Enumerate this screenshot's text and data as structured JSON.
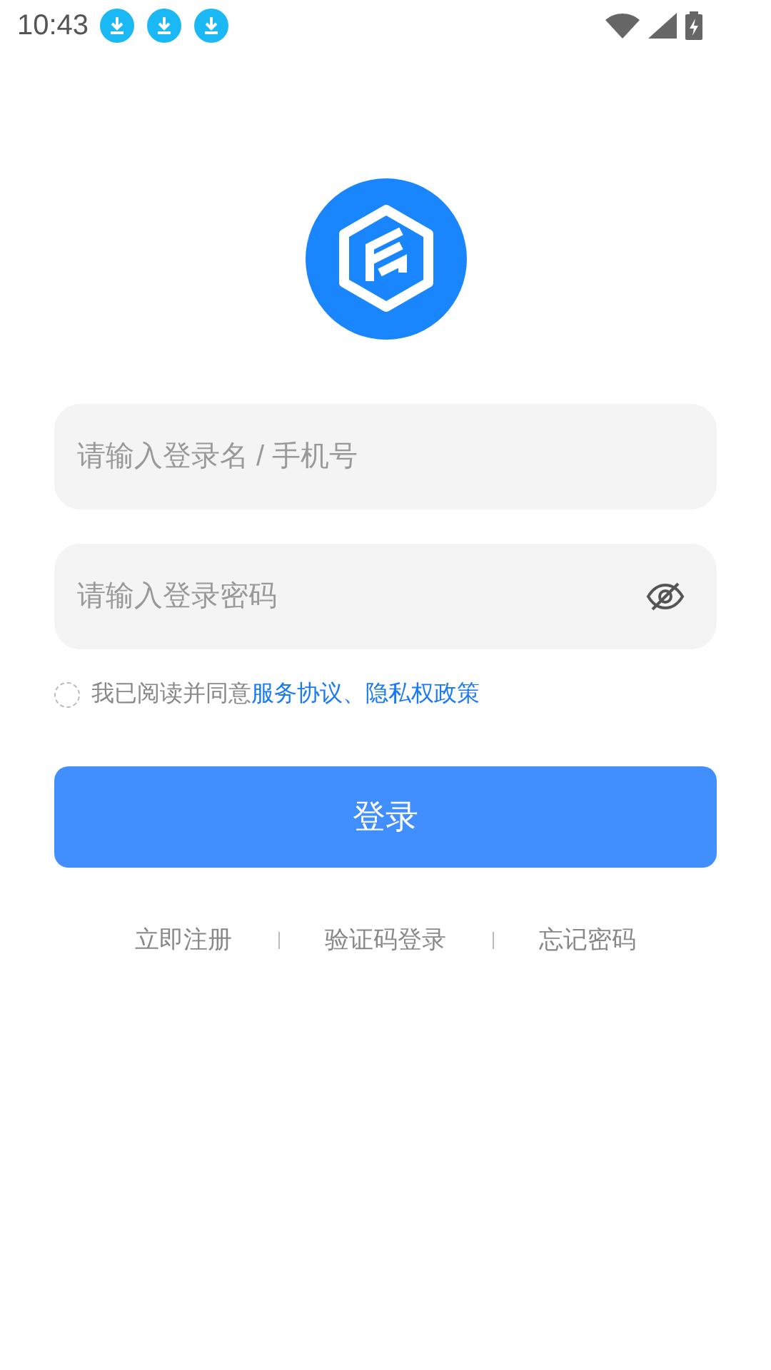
{
  "status_bar": {
    "time": "10:43",
    "notifications": [
      {
        "kind": "download"
      },
      {
        "kind": "download"
      },
      {
        "kind": "download"
      }
    ]
  },
  "login_name_field": {
    "placeholder": "请输入登录名 / 手机号"
  },
  "password_field": {
    "placeholder": "请输入登录密码",
    "password_visible": false
  },
  "agreement": {
    "checked": false,
    "text": "我已阅读并同意",
    "link": "服务协议、隐私权政策"
  },
  "login_button": "登录",
  "footer_links": [
    "立即注册",
    "验证码登录",
    "忘记密码"
  ]
}
